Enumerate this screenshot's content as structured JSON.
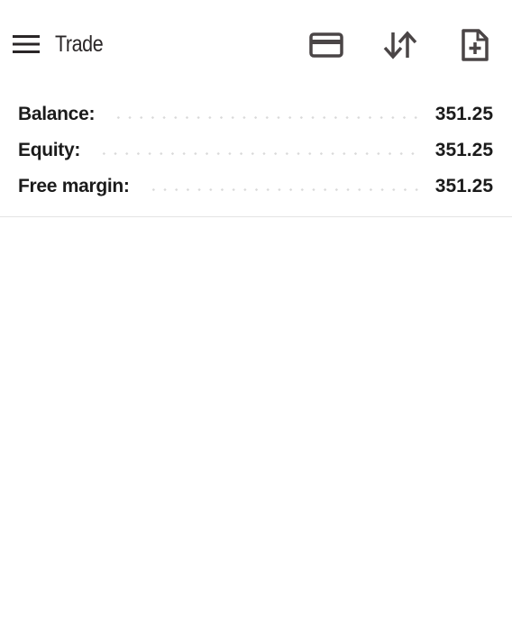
{
  "toolbar": {
    "title": "Trade",
    "icons": {
      "menu": "hamburger-menu-icon",
      "deposit": "credit-card-icon",
      "sort": "sort-arrows-icon",
      "new_order": "new-document-icon"
    },
    "icon_color": "#4a4546"
  },
  "account": {
    "rows": [
      {
        "label": "Balance:",
        "value": "351.25"
      },
      {
        "label": "Equity:",
        "value": "351.25"
      },
      {
        "label": "Free margin:",
        "value": "351.25"
      }
    ]
  }
}
